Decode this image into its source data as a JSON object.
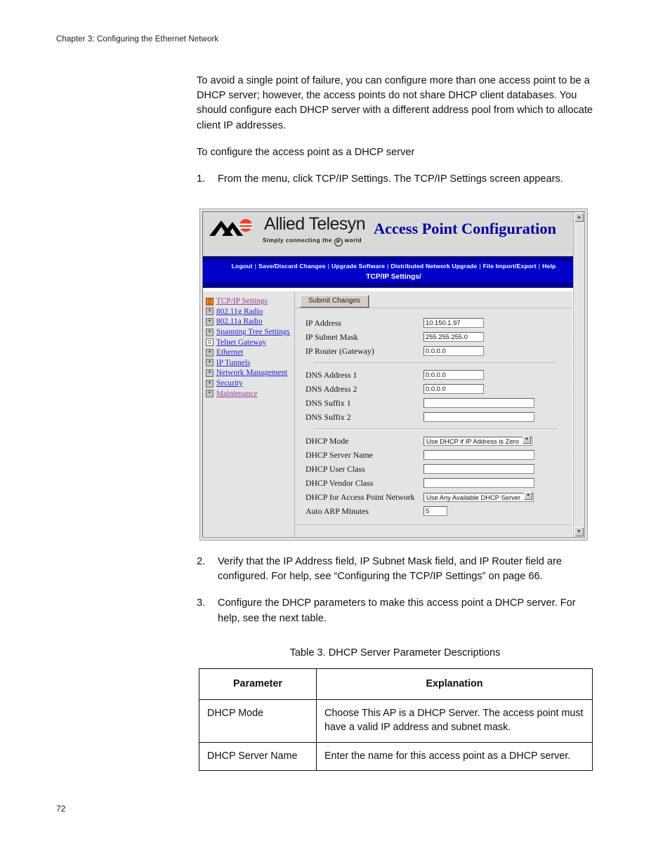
{
  "page": {
    "chapter_header": "Chapter 3: Configuring the Ethernet Network",
    "page_number": "72"
  },
  "prose": {
    "paragraph_1": "To avoid a single point of failure, you can configure more than one access point to be a DHCP server; however, the access points do not share DHCP client databases. You should configure each DHCP server with a different address pool from which to allocate client IP addresses.",
    "paragraph_2": "To configure the access point as a DHCP server",
    "step_1_num": "1.",
    "step_1_text": "From the menu, click TCP/IP Settings. The TCP/IP Settings screen appears.",
    "step_2_num": "2.",
    "step_2_text": "Verify that the IP Address field, IP Subnet Mask field, and IP Router field are configured. For help, see “Configuring the TCP/IP Settings” on page 66.",
    "step_3_num": "3.",
    "step_3_text": "Configure the DHCP parameters to make this access point a DHCP server. For help, see the next table."
  },
  "screenshot": {
    "brand": {
      "name": "Allied Telesyn",
      "tagline_before": "Simply  connecting  the",
      "tagline_ip": "IP",
      "tagline_after": "world",
      "accent_color": "#e8402a"
    },
    "app_title": "Access Point Configuration",
    "nav": {
      "links": [
        "Logout",
        "Save/Discard Changes",
        "Upgrade Software",
        "Distributed Network Upgrade",
        "File Import/Export",
        "Help"
      ],
      "separator": "|",
      "current_page": "TCP/IP Settings/",
      "bar_color": "#0000c8"
    },
    "sidebar": {
      "items": [
        {
          "label": "TCP/IP Settings",
          "icon": "active-page-icon",
          "state": "selected"
        },
        {
          "label": "802.11g Radio",
          "icon": "folder-plus-icon",
          "state": "link"
        },
        {
          "label": "802.11a Radio",
          "icon": "folder-plus-icon",
          "state": "link"
        },
        {
          "label": "Spanning Tree Settings",
          "icon": "folder-plus-icon",
          "state": "link"
        },
        {
          "label": "Telnet Gateway",
          "icon": "page-icon",
          "state": "link"
        },
        {
          "label": "Ethernet",
          "icon": "folder-plus-icon",
          "state": "link"
        },
        {
          "label": "IP Tunnels",
          "icon": "folder-plus-icon",
          "state": "link"
        },
        {
          "label": "Network Management",
          "icon": "folder-plus-icon",
          "state": "link"
        },
        {
          "label": "Security",
          "icon": "folder-plus-icon",
          "state": "link"
        },
        {
          "label": "Maintenance",
          "icon": "folder-plus-icon",
          "state": "visited"
        }
      ]
    },
    "submit_button": "Submit Changes",
    "form": {
      "ip_address": {
        "label": "IP Address",
        "value": "10.150.1.97"
      },
      "ip_subnet_mask": {
        "label": "IP Subnet Mask",
        "value": "255.255.255.0"
      },
      "ip_router": {
        "label": "IP Router (Gateway)",
        "value": "0.0.0.0"
      },
      "dns_address_1": {
        "label": "DNS Address 1",
        "value": "0.0.0.0"
      },
      "dns_address_2": {
        "label": "DNS Address 2",
        "value": "0.0.0.0"
      },
      "dns_suffix_1": {
        "label": "DNS Suffix 1",
        "value": ""
      },
      "dns_suffix_2": {
        "label": "DNS Suffix 2",
        "value": ""
      },
      "dhcp_mode": {
        "label": "DHCP Mode",
        "value": "Use DHCP if IP Address is Zero"
      },
      "dhcp_server_name": {
        "label": "DHCP Server Name",
        "value": ""
      },
      "dhcp_user_class": {
        "label": "DHCP User Class",
        "value": ""
      },
      "dhcp_vendor_class": {
        "label": "DHCP Vendor Class",
        "value": ""
      },
      "dhcp_for_ap_network": {
        "label": "DHCP for Access Point Network",
        "value": "Use Any Available DHCP Server"
      },
      "auto_arp_minutes": {
        "label": "Auto ARP Minutes",
        "value": "5"
      }
    },
    "scrollbar": {
      "up_arrow": "▲",
      "down_arrow": "▼"
    },
    "dropdown_arrow": "▼"
  },
  "table": {
    "caption": "Table 3. DHCP Server Parameter Descriptions",
    "headers": [
      "Parameter",
      "Explanation"
    ],
    "rows": [
      {
        "parameter": "DHCP Mode",
        "explanation": "Choose This AP is a DHCP Server. The access point must have a valid IP address and subnet mask."
      },
      {
        "parameter": "DHCP Server Name",
        "explanation": "Enter the name for this access point as a DHCP server."
      }
    ]
  }
}
